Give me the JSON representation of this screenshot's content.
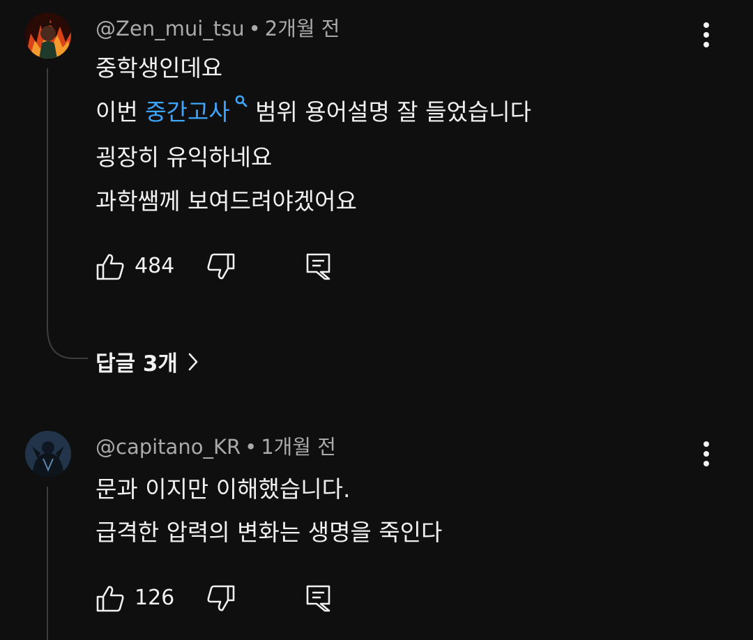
{
  "comments": [
    {
      "author": "@Zen_mui_tsu",
      "separator": "•",
      "time": "2개월 전",
      "lines": [
        {
          "text": "중학생인데요"
        },
        {
          "before": "이번 ",
          "link": "중간고사",
          "after": " 범위 용어설명 잘 들었습니다"
        },
        {
          "text": "굉장히 유익하네요"
        },
        {
          "text": "과학쌤께 보여드려야겠어요"
        }
      ],
      "likes": "484",
      "replies_label": "답글 3개"
    },
    {
      "author": "@capitano_KR",
      "separator": "•",
      "time": "1개월 전",
      "lines": [
        {
          "text": "문과 이지만 이해했습니다."
        },
        {
          "text": "급격한 압력의 변화는 생명을 죽인다"
        }
      ],
      "likes": "126"
    }
  ],
  "icons": {
    "like": "thumb-up-icon",
    "dislike": "thumb-down-icon",
    "reply": "comment-reply-icon",
    "more": "more-vert-icon",
    "link_search": "search-icon",
    "chevron": "chevron-right-icon"
  },
  "colors": {
    "background": "#0f0f0f",
    "text": "#f1f1f1",
    "meta": "#aaaaaa",
    "link": "#3ea6ff",
    "thread_line": "#3d3d3d"
  }
}
